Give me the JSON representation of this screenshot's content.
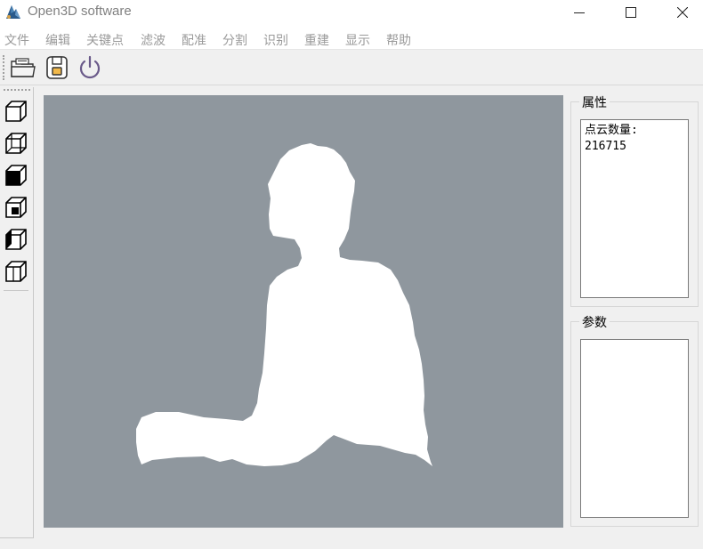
{
  "window": {
    "title": "Open3D software",
    "controls": {
      "minimize": "minimize-icon",
      "maximize": "maximize-icon",
      "close": "close-icon"
    }
  },
  "menu": [
    "文件",
    "编辑",
    "关键点",
    "滤波",
    "配准",
    "分割",
    "识别",
    "重建",
    "显示",
    "帮助"
  ],
  "toolbar": {
    "buttons": [
      "open-folder-icon",
      "save-icon",
      "power-icon"
    ]
  },
  "view_toolbar": {
    "buttons": [
      "view-cube-front-icon",
      "view-cube-back-icon",
      "view-cube-left-icon",
      "view-cube-right-icon",
      "view-cube-top-icon",
      "view-cube-bottom-icon"
    ]
  },
  "viewport": {
    "background_color": "#8f979e",
    "point_color": "#ffffff",
    "content": "human-point-cloud"
  },
  "properties": {
    "title": "属性",
    "point_count_label": "点云数量:",
    "point_count_value": "216715"
  },
  "params": {
    "title": "参数"
  }
}
